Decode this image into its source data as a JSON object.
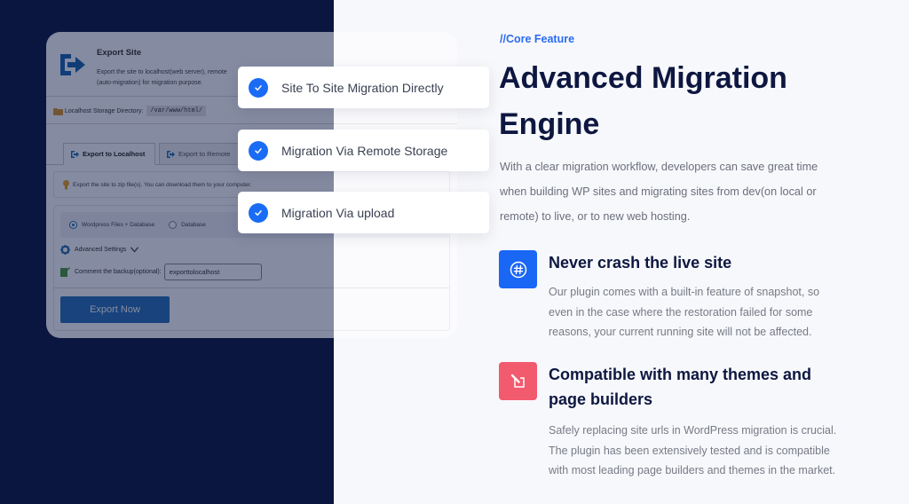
{
  "card": {
    "title": "Export Site",
    "description_lines": [
      "Export the site to localhost(web server), remote",
      "(auto-migration) for migration purpose."
    ],
    "storage_label": "Localhost Storage Directory:",
    "storage_path": "/var/www/html/",
    "tabs": [
      {
        "label": "Export to Localhost",
        "active": true
      },
      {
        "label": "Export to Remote",
        "active": false
      }
    ],
    "info_text": "Export the site to zip file(s). You can download them to your computer.",
    "radio_options": [
      {
        "label": "Wordpress Files + Database",
        "checked": true
      },
      {
        "label": "Database",
        "checked": false
      }
    ],
    "advanced_settings_label": "Advanced Settings",
    "comment_label": "Comment the backup(optional):",
    "comment_value": "exporttolocalhost",
    "export_button_label": "Export Now"
  },
  "badges": [
    {
      "label": "Site To Site Migration Directly",
      "icon": "check-circle-icon"
    },
    {
      "label": "Migration Via Remote Storage",
      "icon": "check-circle-icon"
    },
    {
      "label": "Migration Via upload",
      "icon": "check-circle-icon"
    }
  ],
  "section": {
    "eyebrow": "//Core Feature",
    "headline_lines": [
      "Advanced Migration",
      "Engine"
    ],
    "description_lines": [
      "With a clear migration workflow, developers can save great time",
      "when building WP sites and migrating sites from dev(on local or",
      "remote) to live, or to new web hosting."
    ],
    "features": [
      {
        "icon": "hash-circle-icon",
        "title_lines": [
          "Never crash the live site"
        ],
        "description_lines": [
          "Our plugin comes with a built-in feature of snapshot, so",
          "even in the case where the restoration failed for some",
          "reasons, your current running site will not be affected."
        ]
      },
      {
        "icon": "edit-square-icon",
        "title_lines": [
          "Compatible with many themes and",
          "page builders"
        ],
        "description_lines": [
          "Safely replacing site urls in WordPress migration is crucial.",
          "The plugin has been extensively tested and is compatible",
          "with most leading page builders and themes in the market."
        ]
      }
    ]
  },
  "colors": {
    "navy": "#0b1640",
    "accent_blue": "#1a6cf5",
    "accent_red": "#f25a6e",
    "heading": "#0d1740",
    "body_text": "#6b6f7d"
  }
}
